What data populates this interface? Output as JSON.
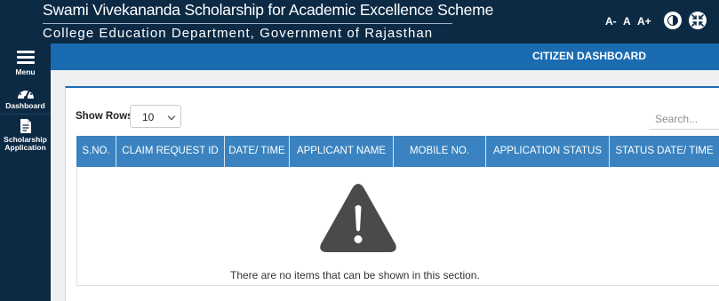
{
  "header": {
    "title": "Swami Vivekananda Scholarship for Academic Excellence Scheme",
    "subtitle": "College Education Department, Government of Rajasthan",
    "font_decrease": "A-",
    "font_normal": "A",
    "font_increase": "A+",
    "contrast_icon": "contrast-icon",
    "compress_icon": "compress-icon"
  },
  "sidebar": {
    "items": [
      {
        "label": "Menu",
        "icon": "hamburger-icon"
      },
      {
        "label": "Dashboard",
        "icon": "gauge-icon"
      },
      {
        "label": "Scholarship Application",
        "icon": "document-icon"
      }
    ]
  },
  "page": {
    "banner_title": "CITIZEN DASHBOARD"
  },
  "table_controls": {
    "show_rows_label": "Show Rows",
    "show_rows_value": "10",
    "search_placeholder": "Search..."
  },
  "table": {
    "columns": [
      "S.NO.",
      "CLAIM REQUEST ID",
      "DATE/ TIME",
      "APPLICANT NAME",
      "MOBILE NO.",
      "APPLICATION STATUS",
      "STATUS DATE/ TIME"
    ],
    "rows": [],
    "empty_message": "There are no items that can be shown in this section.",
    "empty_icon": "warning-icon"
  },
  "colors": {
    "header_bg": "#0d2a45",
    "banner_bg": "#1a6bb0",
    "table_header_bg": "#3a83c0",
    "warning_icon": "#4a4a4a"
  }
}
